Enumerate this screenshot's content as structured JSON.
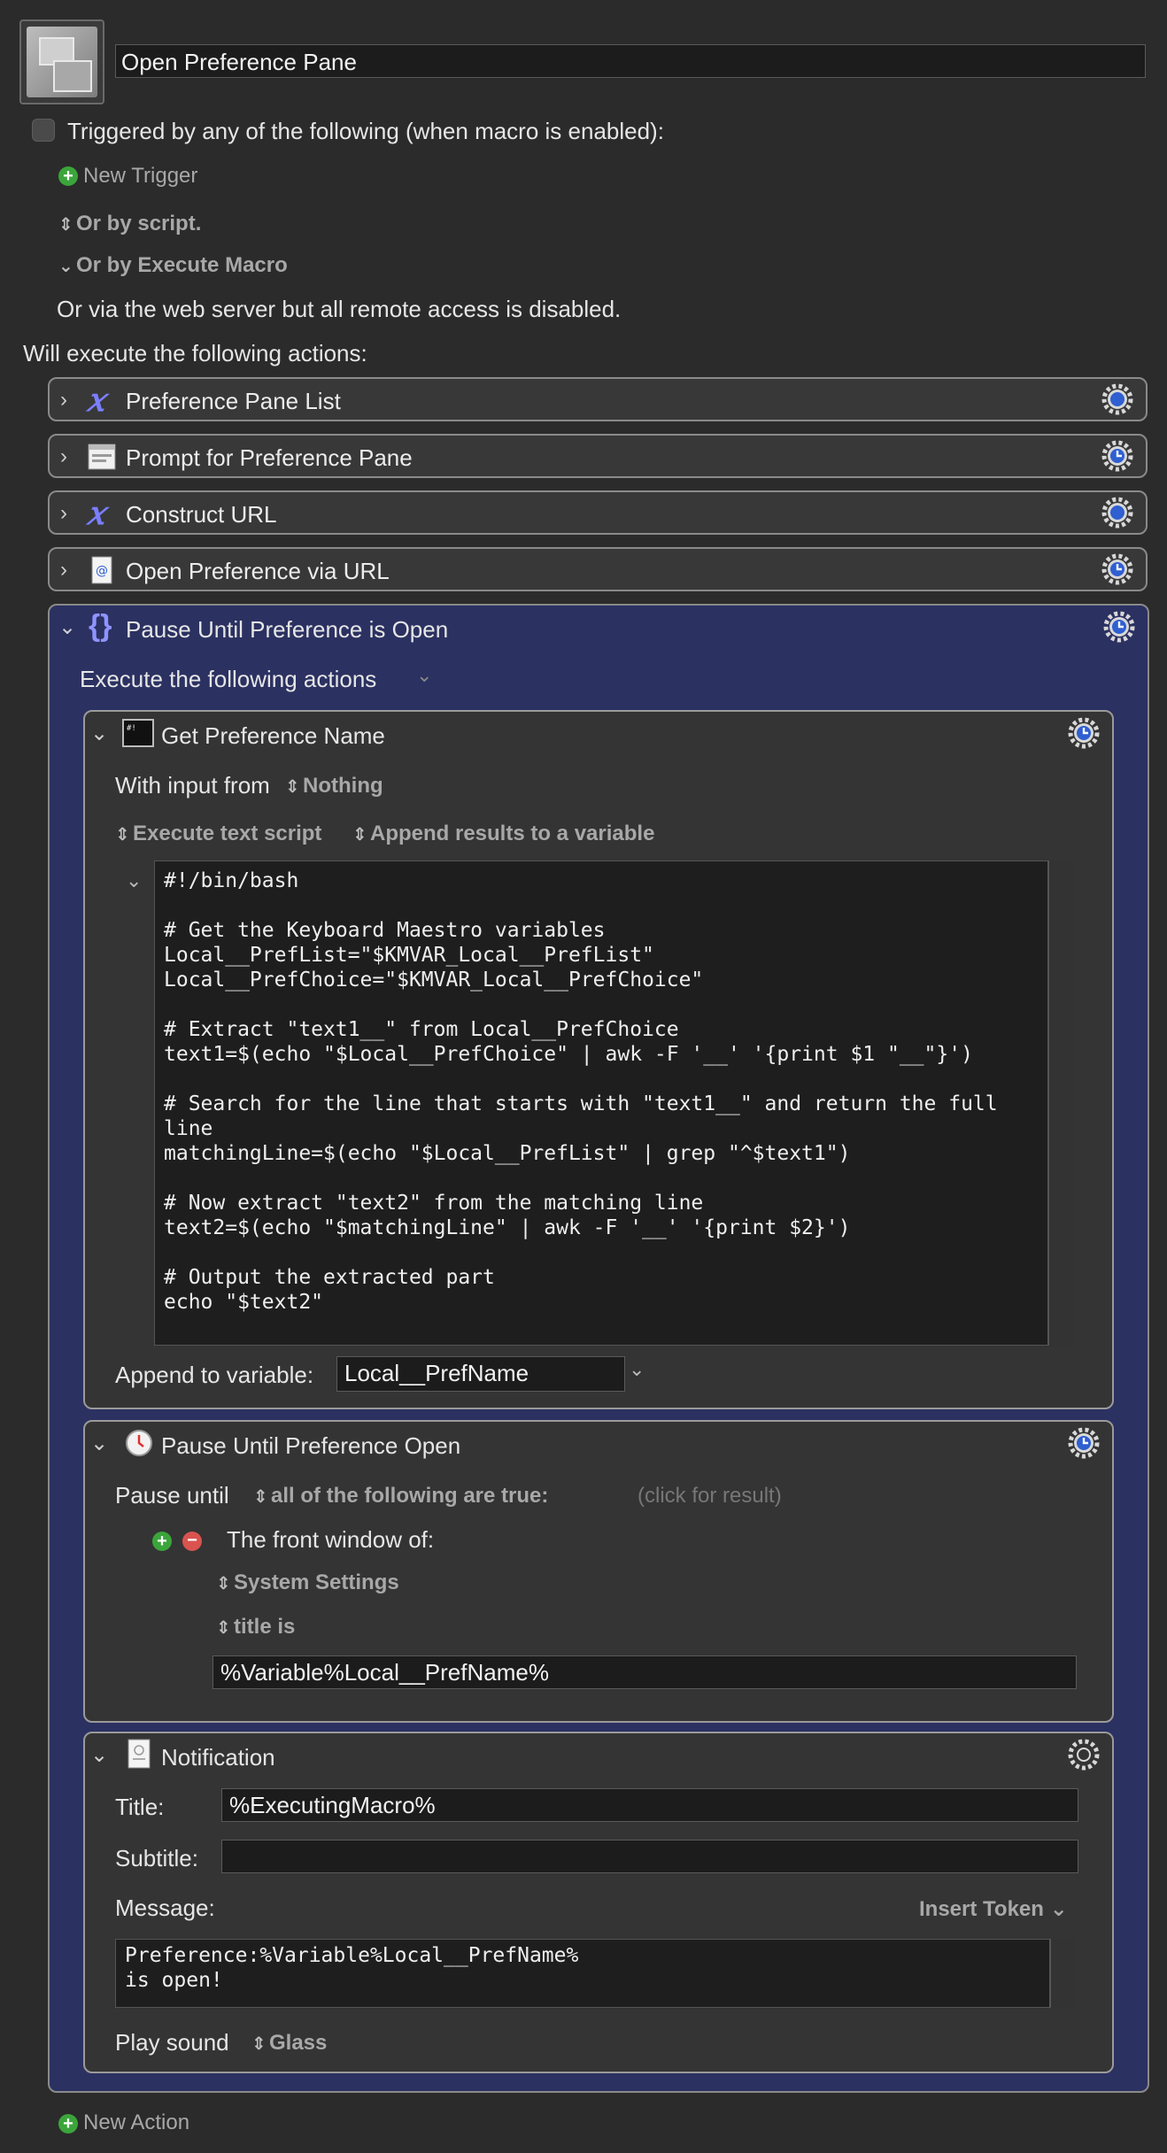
{
  "macro": {
    "name": "Open Preference Pane"
  },
  "triggers": {
    "header": "Triggered by any of the following (when macro is enabled):",
    "new_trigger": "New Trigger",
    "or_by_script": "Or by script.",
    "or_by_execute_macro": "Or by Execute Macro",
    "web_server_note": "Or via the web server but all remote access is disabled."
  },
  "actions_header": "Will execute the following actions:",
  "actions": [
    {
      "label": "Preference Pane List",
      "icon": "variable-icon"
    },
    {
      "label": "Prompt for Preference Pane",
      "icon": "prompt-window-icon"
    },
    {
      "label": "Construct URL",
      "icon": "variable-icon"
    },
    {
      "label": "Open Preference via URL",
      "icon": "url-document-icon"
    }
  ],
  "pause_group": {
    "label": "Pause Until Preference is Open",
    "execute_label": "Execute the following actions",
    "shell": {
      "label": "Get Preference Name",
      "input_label": "With input from",
      "input_value": "Nothing",
      "mode": "Execute text script",
      "result_mode": "Append results to a variable",
      "code": "#!/bin/bash\n\n# Get the Keyboard Maestro variables\nLocal__PrefList=\"$KMVAR_Local__PrefList\"\nLocal__PrefChoice=\"$KMVAR_Local__PrefChoice\"\n\n# Extract \"text1__\" from Local__PrefChoice\ntext1=$(echo \"$Local__PrefChoice\" | awk -F '__' '{print $1 \"__\"}')\n\n# Search for the line that starts with \"text1__\" and return the full\nline\nmatchingLine=$(echo \"$Local__PrefList\" | grep \"^$text1\")\n\n# Now extract \"text2\" from the matching line\ntext2=$(echo \"$matchingLine\" | awk -F '__' '{print $2}')\n\n# Output the extracted part\necho \"$text2\"",
      "append_label": "Append to variable:",
      "append_value": "Local__PrefName"
    },
    "pause": {
      "label": "Pause Until Preference Open",
      "pause_until_label": "Pause until",
      "condition_mode": "all of the following are true:",
      "result_hint": "(click for result)",
      "condition_label": "The front window of:",
      "app": "System Settings",
      "title_cond": "title is",
      "title_value": "%Variable%Local__PrefName%"
    },
    "notification": {
      "label": "Notification",
      "title_label": "Title:",
      "title_value": "%ExecutingMacro%",
      "subtitle_label": "Subtitle:",
      "subtitle_value": "",
      "message_label": "Message:",
      "insert_token": "Insert Token",
      "message_value": "Preference:%Variable%Local__PrefName%\nis open!",
      "sound_label": "Play sound",
      "sound_value": "Glass"
    }
  },
  "new_action": "New Action",
  "colors": {
    "panel_blue": "#2b3161",
    "gear_blue": "#2f5fd0",
    "plus_green": "#3ba53b",
    "minus_red": "#d9534f"
  }
}
